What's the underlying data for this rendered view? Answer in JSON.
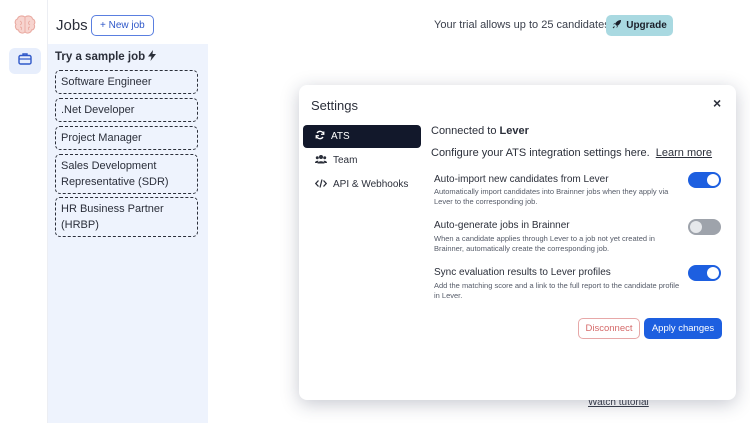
{
  "header": {
    "title": "Jobs",
    "new_job_label": "+ New job",
    "trial_text": "Your trial allows up to 25 candidates",
    "upgrade_label": "Upgrade"
  },
  "rail": {
    "logo_icon": "brain-icon",
    "active_icon": "briefcase-icon"
  },
  "sidebar": {
    "title": "Try a sample job",
    "title_icon": "lightning-icon",
    "jobs": [
      "Software Engineer",
      ".Net Developer",
      "Project Manager",
      "Sales Development Representative (SDR)",
      "HR Business Partner (HRBP)"
    ]
  },
  "background": {
    "watch_tutorial": "Watch tutorial"
  },
  "modal": {
    "title": "Settings",
    "close_label": "×",
    "nav": [
      {
        "label": "ATS",
        "icon": "refresh-icon",
        "active": true
      },
      {
        "label": "Team",
        "icon": "team-icon",
        "active": false
      },
      {
        "label": "API & Webhooks",
        "icon": "code-icon",
        "active": false
      }
    ],
    "connected_prefix": "Connected to",
    "connected_name": "Lever",
    "configure_text": "Configure your ATS integration settings here.",
    "learn_more": "Learn more",
    "options": [
      {
        "title": "Auto-import new candidates from Lever",
        "description": "Automatically import candidates into Brainner jobs when they apply via Lever to the corresponding job.",
        "enabled": true
      },
      {
        "title": "Auto-generate jobs in Brainner",
        "description": "When a candidate applies through Lever to a job not yet created in Brainner, automatically create the corresponding job.",
        "enabled": false
      },
      {
        "title": "Sync evaluation results to Lever profiles",
        "description": "Add the matching score and a link to the full report to the candidate profile in Lever.",
        "enabled": true
      }
    ],
    "disconnect_label": "Disconnect",
    "apply_label": "Apply changes"
  },
  "colors": {
    "accent": "#1d5fe0",
    "sidebar_bg": "#eef3fd",
    "upgrade_bg": "#a9d9e1",
    "danger": "#d56a6a",
    "nav_active_bg": "#12182b"
  }
}
